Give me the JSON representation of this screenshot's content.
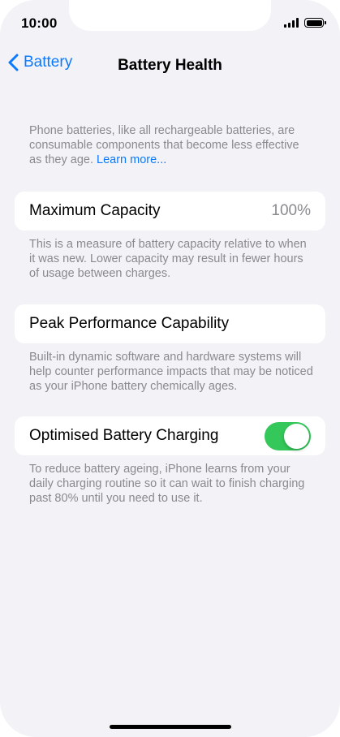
{
  "status_bar": {
    "time": "10:00"
  },
  "nav": {
    "back_label": "Battery",
    "title": "Battery Health"
  },
  "intro": {
    "text": "Phone batteries, like all rechargeable batteries, are consumable components that become less effective as they age.",
    "link": "Learn more..."
  },
  "max_capacity": {
    "label": "Maximum Capacity",
    "value": "100%",
    "note": "This is a measure of battery capacity relative to when it was new. Lower capacity may result in fewer hours of usage between charges."
  },
  "peak_performance": {
    "label": "Peak Performance Capability",
    "note": "Built-in dynamic software and hardware systems will help counter performance impacts that may be noticed as your iPhone battery chemically ages."
  },
  "optimised_charging": {
    "label": "Optimised Battery Charging",
    "enabled": true,
    "note": "To reduce battery ageing, iPhone learns from your daily charging routine so it can wait to finish charging past 80% until you need to use it."
  },
  "colors": {
    "accent": "#0a7aff",
    "toggle_on": "#34c759",
    "background": "#f2f2f7",
    "secondary_text": "#8a8a8e"
  },
  "icons": {
    "back": "chevron-left-icon",
    "signal": "cellular-signal-icon",
    "battery": "battery-icon"
  }
}
